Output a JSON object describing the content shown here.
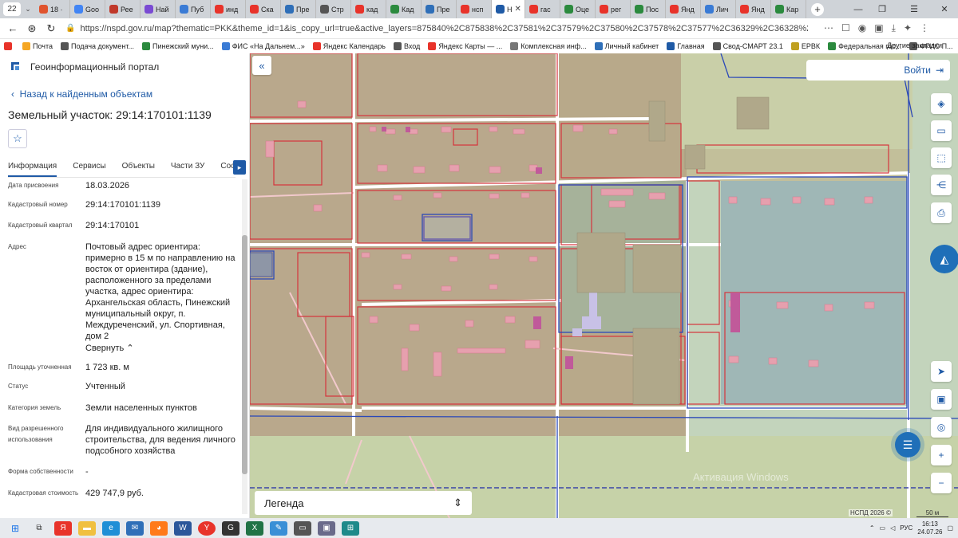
{
  "browser": {
    "tab_counter": "22",
    "tabs": [
      {
        "label": "18 ·",
        "color": "#e0542e"
      },
      {
        "label": "Goo",
        "color": "#4285f4"
      },
      {
        "label": "Рее",
        "color": "#c0392b"
      },
      {
        "label": "Най",
        "color": "#7a4bd3"
      },
      {
        "label": "Пуб",
        "color": "#3a7bd5"
      },
      {
        "label": "инд",
        "color": "#e8332a"
      },
      {
        "label": "Ска",
        "color": "#e8332a"
      },
      {
        "label": "Пре",
        "color": "#2f6fb8"
      },
      {
        "label": "Стр",
        "color": "#555555"
      },
      {
        "label": "кад",
        "color": "#e8332a"
      },
      {
        "label": "Кад",
        "color": "#2b8a3e"
      },
      {
        "label": "Пре",
        "color": "#2f6fb8"
      },
      {
        "label": "нсп",
        "color": "#e8332a"
      },
      {
        "label": "Н",
        "color": "#1f5aa6",
        "active": true
      },
      {
        "label": "гас",
        "color": "#e8332a"
      },
      {
        "label": "Оце",
        "color": "#2b8a3e"
      },
      {
        "label": "рег",
        "color": "#e8332a"
      },
      {
        "label": "Пос",
        "color": "#2b8a3e"
      },
      {
        "label": "Янд",
        "color": "#e8332a"
      },
      {
        "label": "Лич",
        "color": "#3a7bd5"
      },
      {
        "label": "Янд",
        "color": "#e8332a"
      },
      {
        "label": "Кар",
        "color": "#2b8a3e"
      }
    ],
    "url": "https://nspd.gov.ru/map?thematic=PKK&theme_id=1&is_copy_url=true&active_layers=875840%2C875838%2C37581%2C37579%2C37580%2C37578%2C37577%2C36329%2C36328%2C36049%2C37299%2C3...",
    "bookmarks": [
      {
        "label": "",
        "color": "#e8332a"
      },
      {
        "label": "Почта",
        "color": "#f5a623"
      },
      {
        "label": "Подача документ...",
        "color": "#555555"
      },
      {
        "label": "Пинежский муни...",
        "color": "#2b8a3e"
      },
      {
        "label": "ФИС «На Дальнем...»",
        "color": "#3a7bd5"
      },
      {
        "label": "Яндекс Календарь",
        "color": "#e8332a"
      },
      {
        "label": "Вход",
        "color": "#555555"
      },
      {
        "label": "Яндекс Карты — ...",
        "color": "#e8332a"
      },
      {
        "label": "Комплексная инф...",
        "color": "#777777"
      },
      {
        "label": "Личный кабинет",
        "color": "#2f6fb8"
      },
      {
        "label": "Главная",
        "color": "#1f5aa6"
      },
      {
        "label": "Свод-СМАРТ 23.1",
        "color": "#555555"
      },
      {
        "label": "ЕРВК",
        "color": "#c0a020"
      },
      {
        "label": "Федеральная гос...",
        "color": "#2b8a3e"
      },
      {
        "label": "ФГИС П...",
        "color": "#555555"
      }
    ],
    "other_bookmarks": "Другие закладки"
  },
  "sidebar": {
    "portal_title": "Геоинформационный портал",
    "back_link": "Назад к найденным объектам",
    "parcel_title": "Земельный участок: 29:14:170101:1139",
    "tabs": [
      "Информация",
      "Сервисы",
      "Объекты",
      "Части ЗУ",
      "Состав"
    ],
    "fields": [
      {
        "label": "Дата присвоения",
        "value": "18.03.2026"
      },
      {
        "label": "Кадастровый номер",
        "value": "29:14:170101:1139"
      },
      {
        "label": "Кадастровый квартал",
        "value": "29:14:170101"
      },
      {
        "label": "Адрес",
        "value": "Почтовый адрес ориентира: примерно в 15 м по направлению на восток от ориентира (здание), расположенного за пределами участка, адрес ориентира: Архангельская область, Пинежский муниципальный округ, п. Междуреченский, ул. Спортивная, дом 2"
      },
      {
        "label": "Площадь уточненная",
        "value": "1 723 кв. м"
      },
      {
        "label": "Статус",
        "value": "Учтенный"
      },
      {
        "label": "Категория земель",
        "value": "Земли населенных пунктов"
      },
      {
        "label": "Вид разрешенного использования",
        "value": "Для индивидуального жилищного строительства, для ведения личного подсобного хозяйства"
      },
      {
        "label": "Форма собственности",
        "value": "-"
      },
      {
        "label": "Кадастровая стоимость",
        "value": "429 747,9 руб."
      }
    ],
    "collapse_label": "Свернуть"
  },
  "map": {
    "login_label": "Войти",
    "legend_label": "Легенда",
    "credit": "НСПД 2026 ©",
    "scale": "50 м",
    "watermark": "Активация Windows"
  },
  "taskbar": {
    "lang": "РУС",
    "time": "16:13",
    "date": "24.07.26"
  }
}
